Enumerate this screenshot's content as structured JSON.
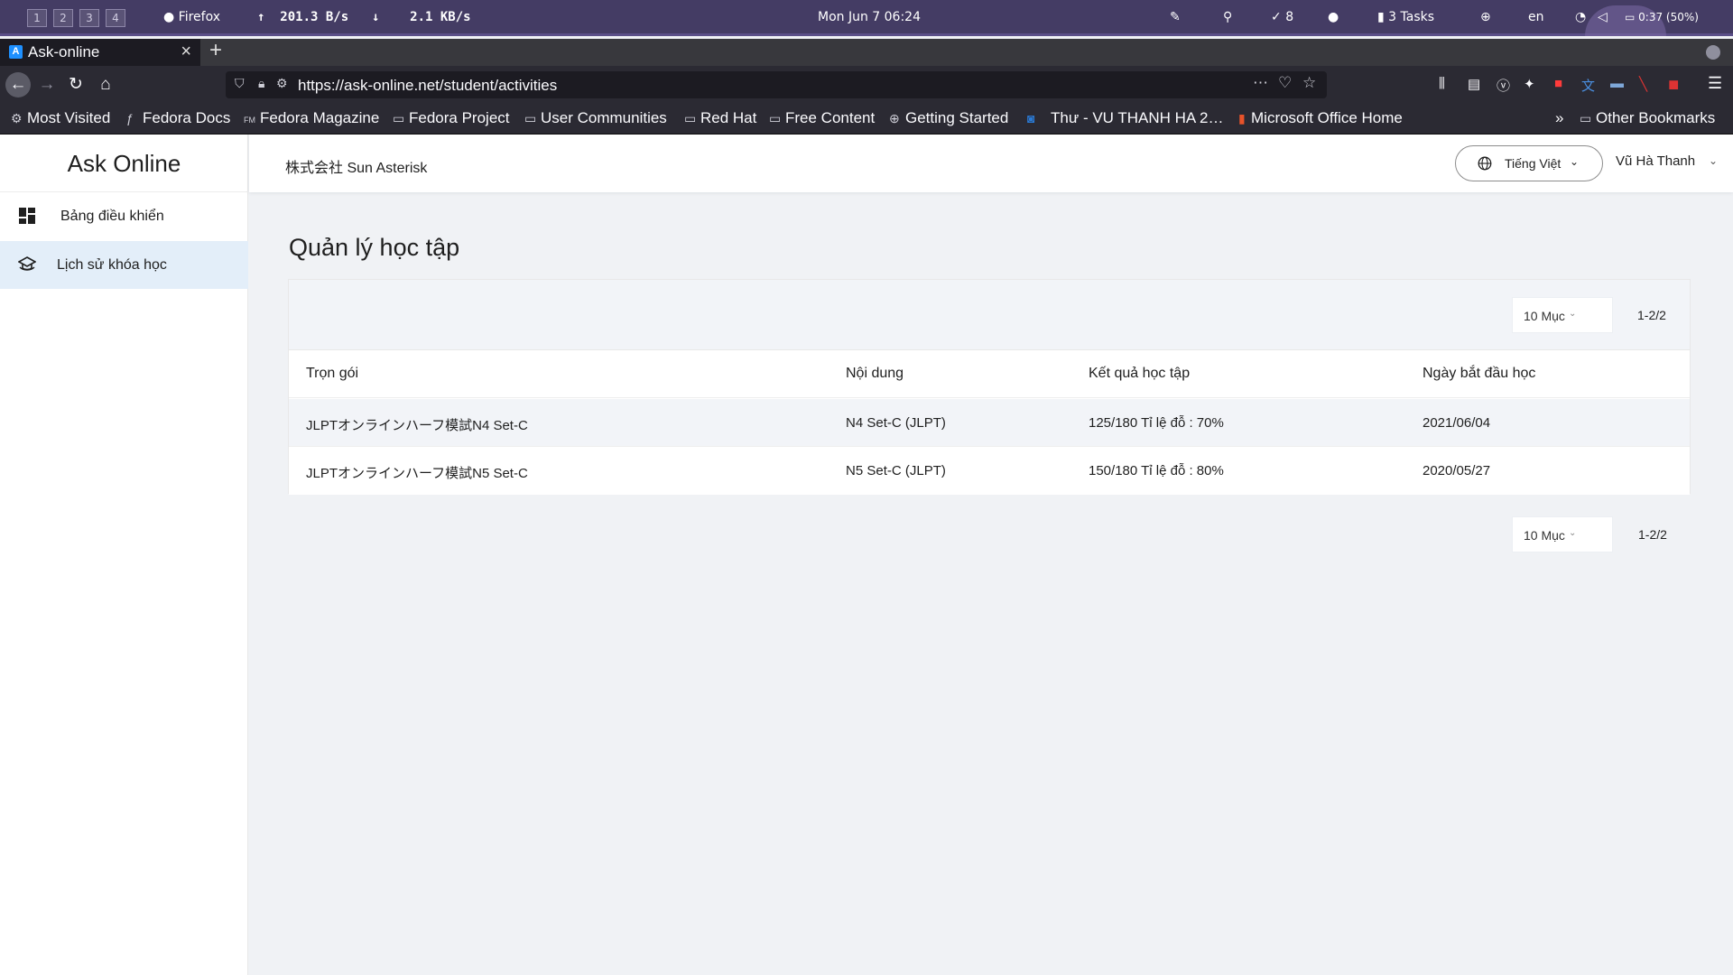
{
  "system_bar": {
    "workspaces": [
      "1",
      "2",
      "3",
      "4"
    ],
    "app_name": "Firefox",
    "upload_speed": "201.3 B/s",
    "download_speed": "2.1 KB/s",
    "datetime": "Mon Jun 7  06:24",
    "updates_count": "8",
    "tasks": "3 Tasks",
    "keyboard_layout": "en",
    "battery": "0:37 (50%)"
  },
  "browser": {
    "tab_title": "Ask-online",
    "tab_favicon": "A",
    "url": "https://ask-online.net/student/activities",
    "bookmarks": [
      {
        "label": "Most Visited",
        "icon": "gear-icon"
      },
      {
        "label": "Fedora Docs",
        "icon": "fedora-icon"
      },
      {
        "label": "Fedora Magazine",
        "icon": "fm-icon"
      },
      {
        "label": "Fedora Project",
        "icon": "folder-icon"
      },
      {
        "label": "User Communities",
        "icon": "folder-icon"
      },
      {
        "label": "Red Hat",
        "icon": "folder-icon"
      },
      {
        "label": "Free Content",
        "icon": "folder-icon"
      },
      {
        "label": "Getting Started",
        "icon": "globe-icon"
      },
      {
        "label": "Thư - VU THANH HA 2…",
        "icon": "outlook-icon"
      },
      {
        "label": "Microsoft Office Home",
        "icon": "office-icon"
      }
    ],
    "other_bookmarks": "Other Bookmarks"
  },
  "app": {
    "logo": "Ask Online",
    "sidebar": {
      "items": [
        {
          "label": "Bảng điều khiển",
          "icon": "dashboard-icon",
          "active": false
        },
        {
          "label": "Lịch sử khóa học",
          "icon": "course-history-icon",
          "active": true
        }
      ]
    },
    "header": {
      "company": "株式会社 Sun Asterisk",
      "language": "Tiếng Việt",
      "user_name": "Vũ Hà Thanh"
    },
    "page_title": "Quản lý học tập",
    "pagination": {
      "page_size": "10 Mục",
      "range": "1-2/2"
    },
    "table": {
      "columns": [
        "Trọn gói",
        "Nội dung",
        "Kết quả học tập",
        "Ngày bắt đầu học"
      ],
      "rows": [
        [
          "JLPTオンラインハーフ模試N4 Set-C",
          "N4 Set-C (JLPT)",
          "125/180 Tỉ lệ đỗ : 70%",
          "2021/06/04"
        ],
        [
          "JLPTオンラインハーフ模試N5 Set-C",
          "N5 Set-C (JLPT)",
          "150/180 Tỉ lệ đỗ : 80%",
          "2020/05/27"
        ]
      ]
    },
    "colors": {
      "active_menu_bg": "#e3eef9",
      "system_bar_bg": "#443c64",
      "browser_chrome": "#2b2a33"
    }
  }
}
